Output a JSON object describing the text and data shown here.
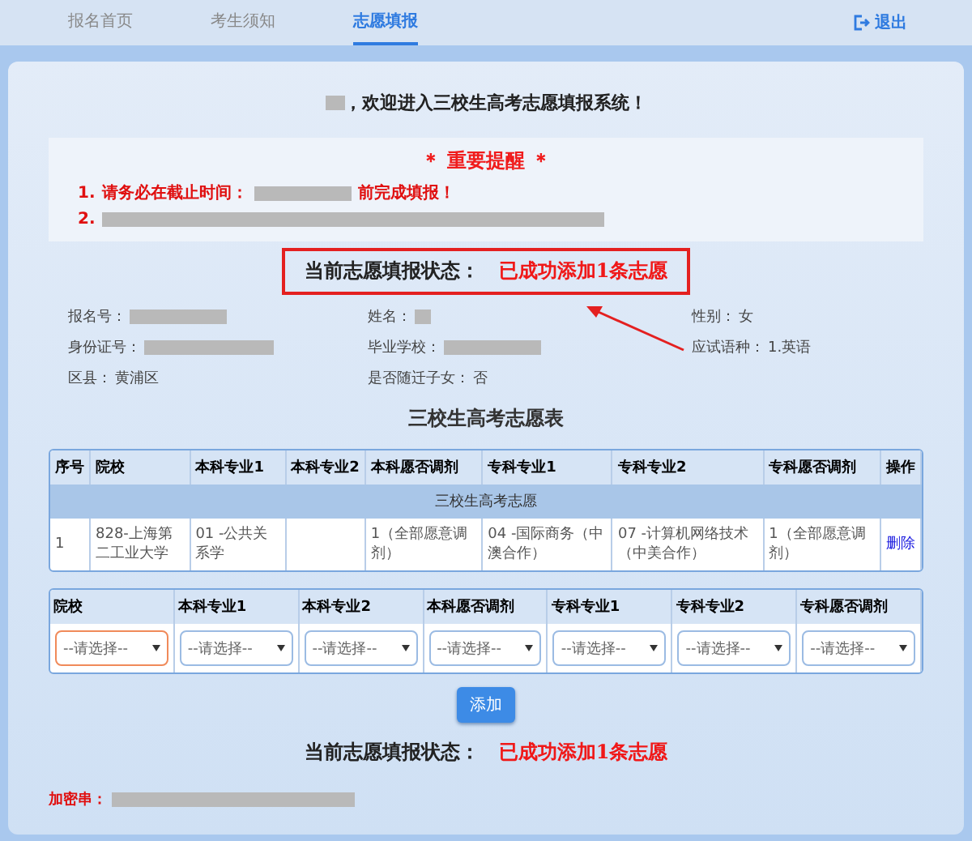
{
  "nav": {
    "tabs": [
      {
        "label": "报名首页",
        "selected": false
      },
      {
        "label": "考生须知",
        "selected": false
      },
      {
        "label": "志愿填报",
        "selected": true
      }
    ],
    "logout": "退出"
  },
  "welcome": {
    "name_redacted": true,
    "text": "，欢迎进入三校生高考志愿填报系统！"
  },
  "reminder": {
    "title": "＊ 重要提醒 ＊",
    "items": [
      {
        "number": "1.",
        "before": "请务必在截止时间：",
        "after": "前完成填报！"
      },
      {
        "number": "2."
      }
    ]
  },
  "status_top": {
    "label": "当前志愿填报状态：",
    "value": "已成功添加1条志愿"
  },
  "info": [
    {
      "label": "报名号：",
      "redacted": true
    },
    {
      "label": "姓名：",
      "redacted": true
    },
    {
      "label": "性别：",
      "value": "女",
      "redacted": false
    },
    {
      "label": "身份证号：",
      "redacted": true
    },
    {
      "label": "毕业学校：",
      "redacted": true
    },
    {
      "label": "应试语种：",
      "value": "1.英语",
      "redacted": false
    },
    {
      "label": "区县：",
      "value": "黄浦区",
      "redacted": false
    },
    {
      "label": "是否随迁子女：",
      "value": "否",
      "redacted": false
    }
  ],
  "table": {
    "title": "三校生高考志愿表",
    "columns": [
      "序号",
      "院校",
      "本科专业1",
      "本科专业2",
      "本科愿否调剂",
      "专科专业1",
      "专科专业2",
      "专科愿否调剂",
      "操作"
    ],
    "group": "三校生高考志愿",
    "rows": [
      {
        "cells": [
          "1",
          "828-上海第二工业大学",
          "01 -公共关系学",
          "",
          "1（全部愿意调剂）",
          "04 -国际商务（中澳合作）",
          "07 -计算机网络技术（中美合作）",
          "1（全部愿意调剂）"
        ],
        "action": "删除"
      }
    ]
  },
  "form": {
    "columns": [
      {
        "label": "院校",
        "placeholder": "--请选择--",
        "focused": true
      },
      {
        "label": "本科专业1",
        "placeholder": "--请选择--",
        "focused": false
      },
      {
        "label": "本科专业2",
        "placeholder": "--请选择--",
        "focused": false
      },
      {
        "label": "本科愿否调剂",
        "placeholder": "--请选择--",
        "focused": false
      },
      {
        "label": "专科专业1",
        "placeholder": "--请选择--",
        "focused": false
      },
      {
        "label": "专科专业2",
        "placeholder": "--请选择--",
        "focused": false
      },
      {
        "label": "专科愿否调剂",
        "placeholder": "--请选择--",
        "focused": false
      }
    ],
    "button": "添加"
  },
  "status_bottom": {
    "label": "当前志愿填报状态：",
    "value": "已成功添加1条志愿"
  },
  "footer": {
    "label": "加密串：",
    "redacted": true
  }
}
